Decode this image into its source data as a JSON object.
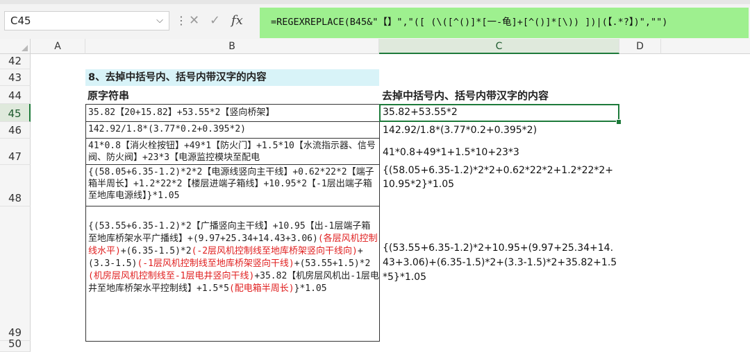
{
  "name_box": {
    "value": "C45"
  },
  "formula_bar": {
    "cancel_glyph": "✕",
    "enter_glyph": "✓",
    "fx_label": "fx",
    "formula": "=REGEXREPLACE(B45&\"【】\",\"([ (\\([^()]*[一-龟]+[^()]*[\\)) ])|(【.*?】)\",\"\")"
  },
  "columns": [
    "A",
    "B",
    "C",
    "D"
  ],
  "rows": [
    "42",
    "43",
    "44",
    "45",
    "46",
    "47",
    "48",
    "49",
    "50"
  ],
  "section_title": "8、去掉中括号内、括号内带汉字的内容",
  "col_b_header": "原字符串",
  "col_c_header": "去掉中括号内、括号内带汉字的内容",
  "source": {
    "r45": "35.82【20+15.82】+53.55*2【竖向桥架】",
    "r46": "142.92/1.8*(3.77*0.2+0.395*2)",
    "r47": "41*0.8【消火栓按钮】+49*1【防火门】+1.5*10【水流指示器、信号阀、防火阀】+23*3【电源监控模块至配电",
    "r48": "{(58.05+6.35-1.2)*2*2【电源线竖向主干线】+0.62*22*2【端子箱半周长】+1.2*22*2【楼层进端子箱线】+10.95*2【-1层出端子箱至地库电源线】}*1.05",
    "r49": {
      "p1": "{(53.55+6.35-1.2)*2【广播竖向主干线】+10.95【出-1层端子箱至地库桥架水平广播线】+(9.97+25.34+14.43+3.06)",
      "p2": "(各层风机控制线水平)",
      "p3": "+(6.35-1.5)*2",
      "p4": "(-2层风机控制线至地库桥架竖向干线向)",
      "p5": "+(3.3-1.5)",
      "p6": "(-1层风机控制线至地库桥架竖向干线)",
      "p7": "+(53.55+1.5)*2",
      "p8": "(机房层风机控制线至-1层电井竖向干线)",
      "p9": "+35.82【机房层风机出-1层电井至地库桥架水平控制线】+1.5*5",
      "p10": "(配电箱半周长)",
      "p11": "}*1.05"
    }
  },
  "result": {
    "r45": "35.82+53.55*2",
    "r46": "142.92/1.8*(3.77*0.2+0.395*2)",
    "r47": "41*0.8+49*1+1.5*10+23*3",
    "r48": "{(58.05+6.35-1.2)*2*2+0.62*22*2+1.2*22*2+10.95*2}*1.05",
    "r49": "{(53.55+6.35-1.2)*2+10.95+(9.97+25.34+14.43+3.06)+(6.35-1.5)*2+(3.3-1.5)*2+35.82+1.5*5}*1.05"
  },
  "colors": {
    "formula_highlight": "#9ef08f",
    "title_fill": "#d8f3f8",
    "selection": "#1d7a3a",
    "red_text": "#e02020"
  }
}
